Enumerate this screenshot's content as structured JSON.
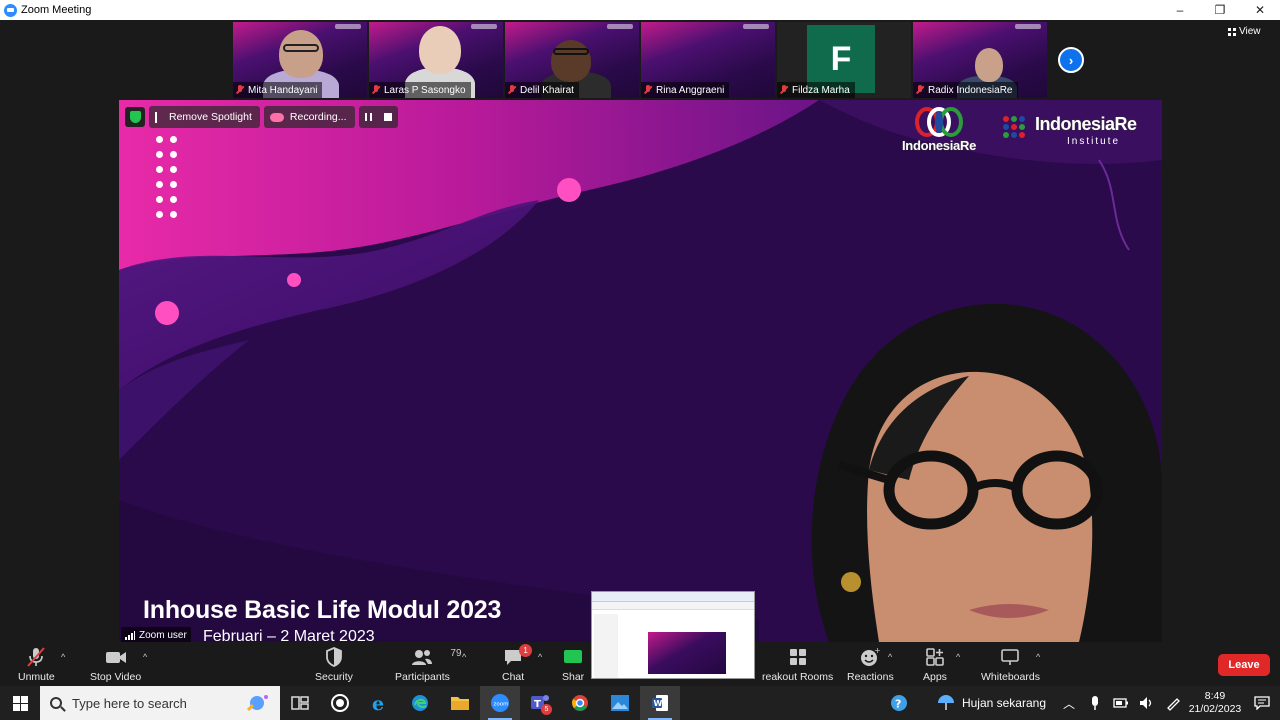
{
  "window": {
    "title": "Zoom Meeting",
    "buttons": [
      "–",
      "❐",
      "✕"
    ]
  },
  "view_label": "View",
  "participants_strip": [
    {
      "name": "Mita Handayani",
      "kind": "video"
    },
    {
      "name": "Laras P Sasongko",
      "kind": "video"
    },
    {
      "name": "Delil Khairat",
      "kind": "video"
    },
    {
      "name": "Rina Anggraeni",
      "kind": "video"
    },
    {
      "name": "Fildza Marha",
      "kind": "avatar",
      "initial": "F"
    },
    {
      "name": "Radix IndonesiaRe",
      "kind": "video"
    }
  ],
  "spotlight": {
    "remove_label": "Remove Spotlight",
    "recording_label": "Recording...",
    "speaker_tag": "Zoom user"
  },
  "slide": {
    "logo1_text": "IndonesiaRe",
    "logo2_title": "IndonesiaRe",
    "logo2_sub": "Institute",
    "title": "Inhouse Basic Life Modul 2023",
    "subtitle": "Februari – 2 Maret 2023"
  },
  "controls": {
    "unmute": "Unmute",
    "stop_video": "Stop Video",
    "security": "Security",
    "participants": "Participants",
    "participants_count": "79",
    "chat": "Chat",
    "chat_badge": "1",
    "share": "Shar",
    "breakout": "reakout Rooms",
    "reactions": "Reactions",
    "apps": "Apps",
    "whiteboards": "Whiteboards",
    "leave": "Leave"
  },
  "taskbar": {
    "search_placeholder": "Type here to search",
    "teams_badge": "5",
    "weather": "Hujan sekarang",
    "time": "8:49",
    "date": "21/02/2023"
  },
  "colors": {
    "accent_blue": "#0e72ed",
    "leave_red": "#e02828",
    "slide_purple": "#2a0a4a",
    "slide_magenta": "#c21b8a"
  }
}
